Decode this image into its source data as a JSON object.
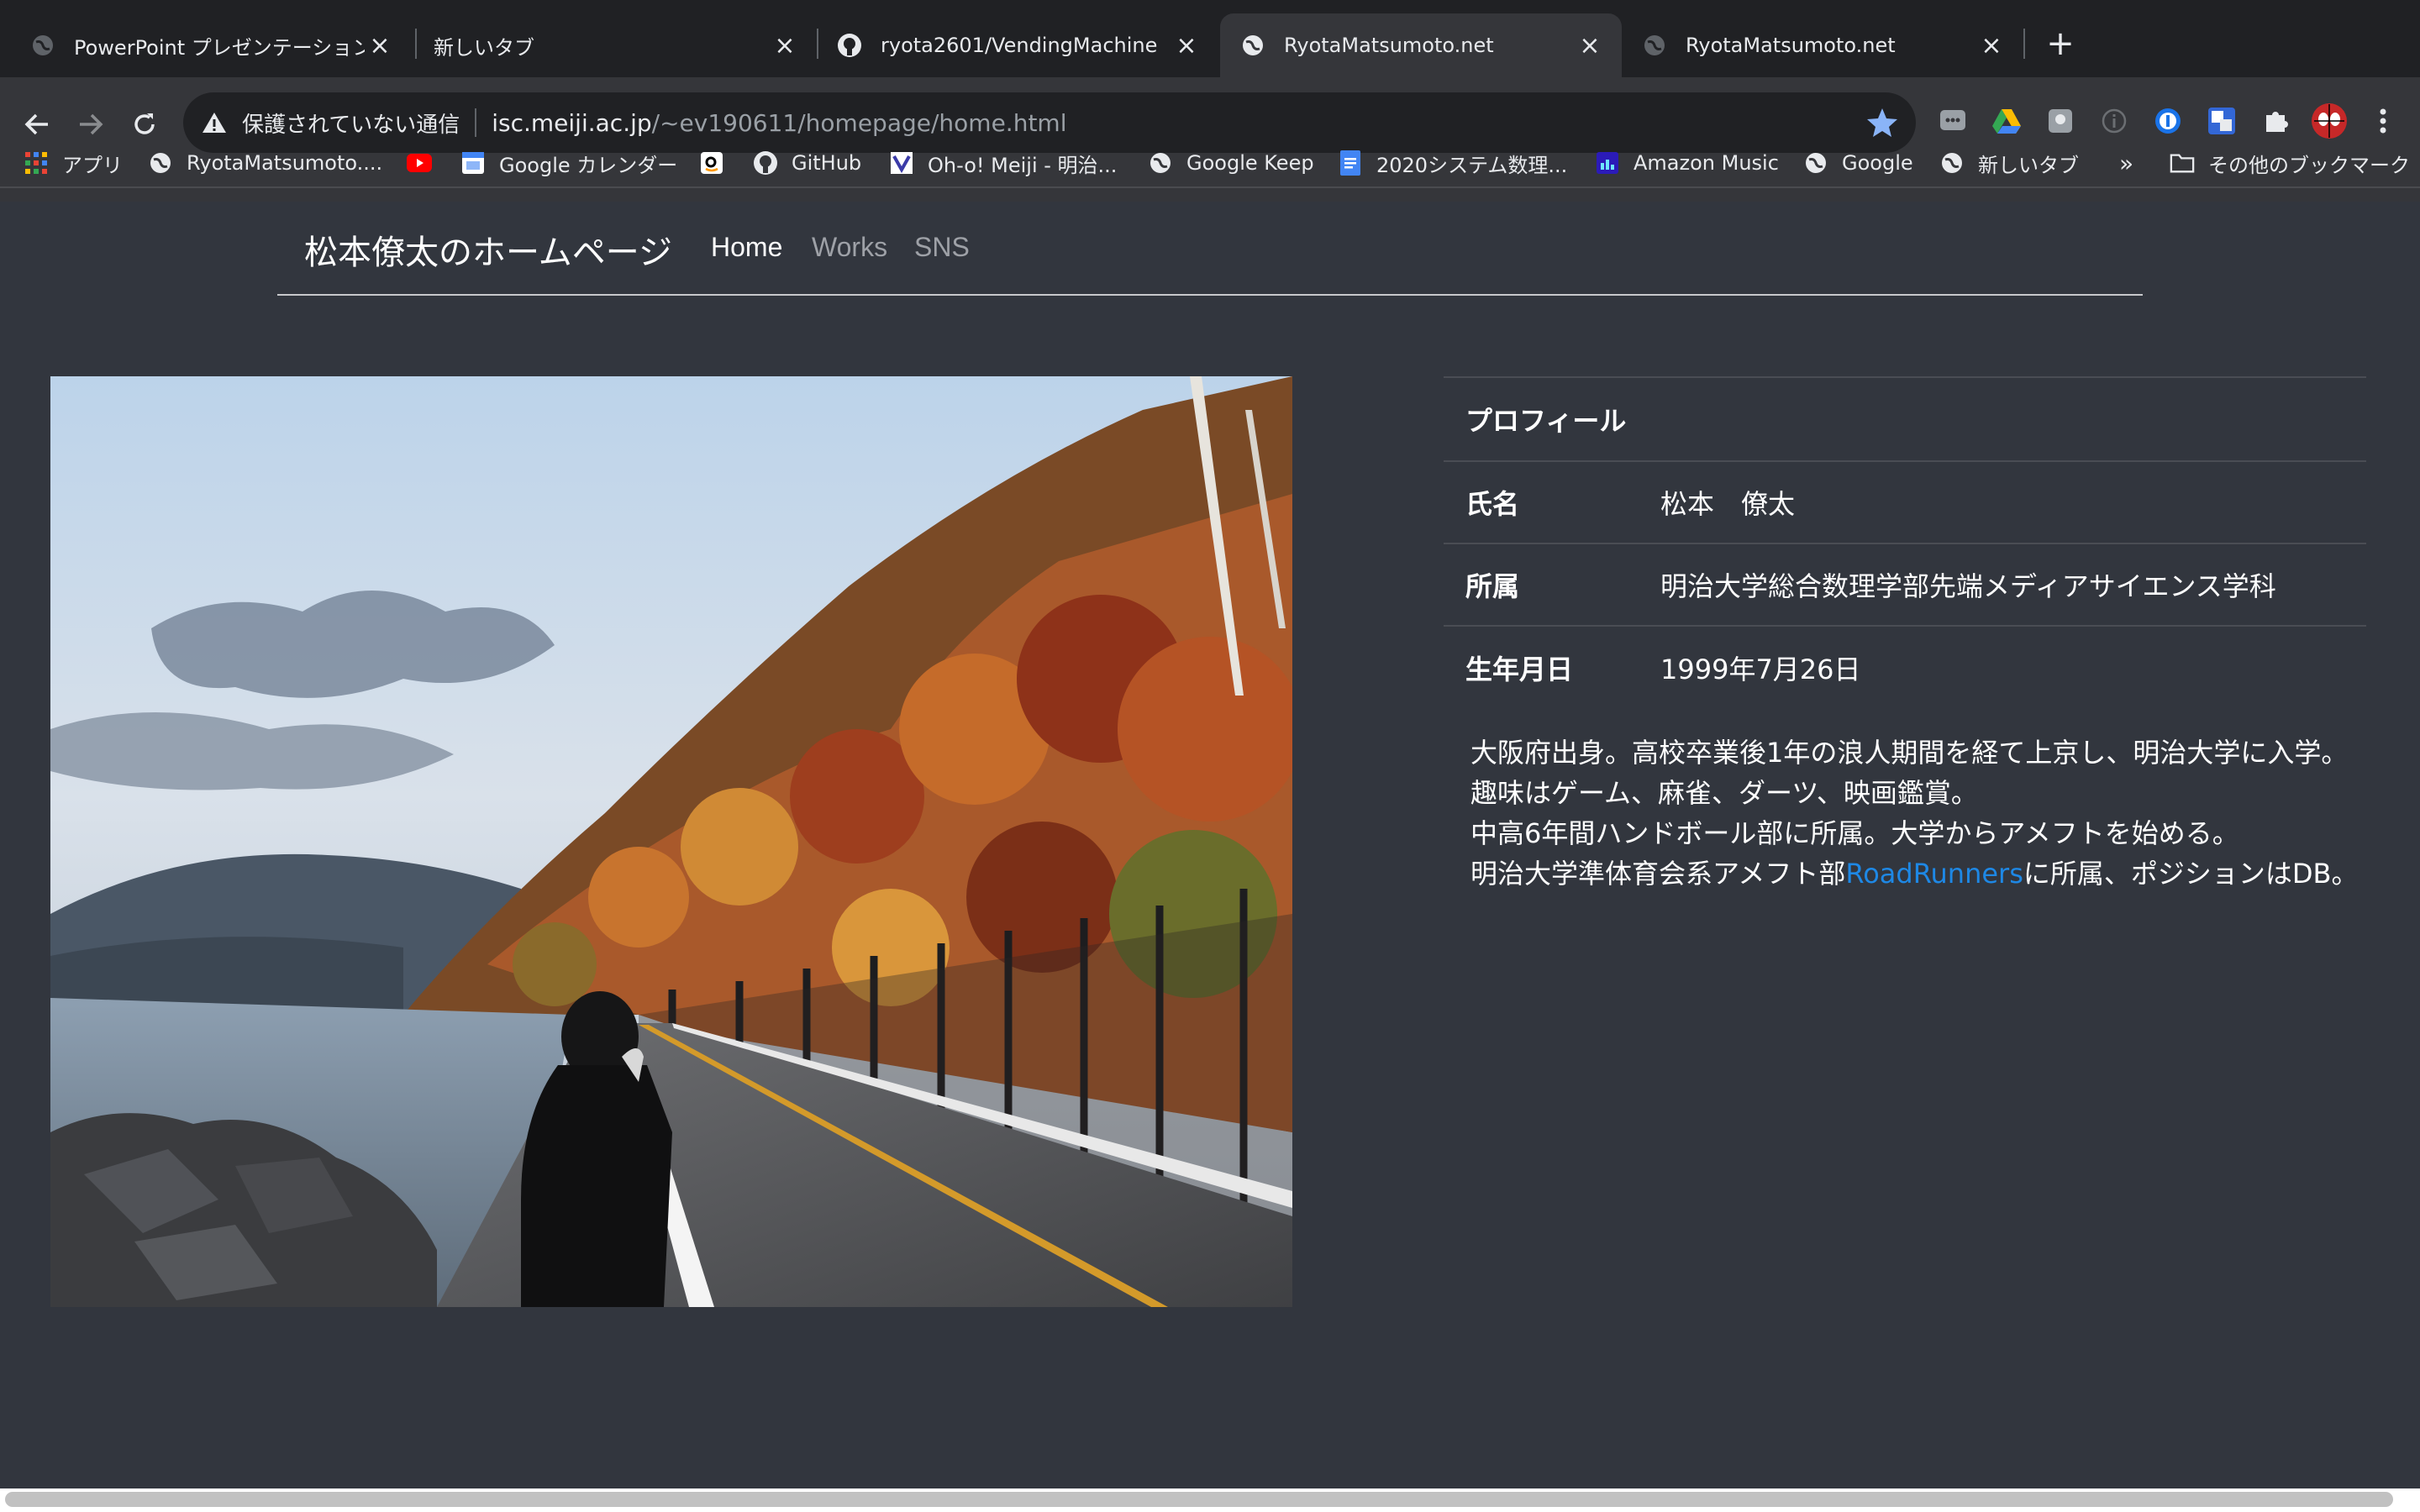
{
  "browser": {
    "tabs": [
      {
        "title": "PowerPoint プレゼンテーション",
        "icon": "globe-icon",
        "active": false
      },
      {
        "title": "新しいタブ",
        "icon": "none",
        "active": false
      },
      {
        "title": "ryota2601/VendingMachine",
        "icon": "github-icon",
        "active": false
      },
      {
        "title": "RyotaMatsumoto.net",
        "icon": "globe-icon",
        "active": true
      },
      {
        "title": "RyotaMatsumoto.net",
        "icon": "globe-icon",
        "active": false
      }
    ],
    "new_tab_label": "+",
    "close_glyph": "×",
    "address": {
      "security_label": "保護されていない通信",
      "host": "isc.meiji.ac.jp",
      "path": "/~ev190611/homepage/home.html"
    },
    "bookmarks": [
      {
        "label": "アプリ",
        "icon": "apps-grid-icon"
      },
      {
        "label": "RyotaMatsumoto....",
        "icon": "globe-icon"
      },
      {
        "label": "",
        "icon": "youtube-icon"
      },
      {
        "label": "Google カレンダー",
        "icon": "calendar-icon"
      },
      {
        "label": "",
        "icon": "amazon-icon"
      },
      {
        "label": "GitHub",
        "icon": "github-icon"
      },
      {
        "label": "Oh-o! Meiji - 明治...",
        "icon": "meiji-icon"
      },
      {
        "label": "Google Keep",
        "icon": "globe-icon"
      },
      {
        "label": "2020システム数理...",
        "icon": "docs-icon"
      },
      {
        "label": "Amazon Music",
        "icon": "amazon-music-icon"
      },
      {
        "label": "Google",
        "icon": "globe-icon"
      },
      {
        "label": "新しいタブ",
        "icon": "globe-icon"
      }
    ],
    "bookmarks_overflow": "»",
    "other_bookmarks": "その他のブックマーク",
    "colors": {
      "frame": "#202124",
      "toolbar": "#35363a",
      "page_bg": "#32363e",
      "link": "#1e88e5",
      "star": "#8ab4f8"
    }
  },
  "site": {
    "brand": "松本僚太のホームページ",
    "nav": [
      {
        "label": "Home",
        "current": true
      },
      {
        "label": "Works",
        "current": false
      },
      {
        "label": "SNS",
        "current": false
      }
    ]
  },
  "profile": {
    "heading": "プロフィール",
    "rows": [
      {
        "label": "氏名",
        "value": "松本　僚太"
      },
      {
        "label": "所属",
        "value": "明治大学総合数理学部先端メディアサイエンス学科"
      },
      {
        "label": "生年月日",
        "value": "1999年7月26日"
      }
    ]
  },
  "bio": {
    "line1": "大阪府出身。高校卒業後1年の浪人期間を経て上京し、明治大学に入学。",
    "line2": "趣味はゲーム、麻雀、ダーツ、映画鑑賞。",
    "line3": "中高6年間ハンドボール部に所属。大学からアメフトを始める。",
    "line4_before": "明治大学準体育会系アメフト部",
    "line4_link": "RoadRunners",
    "line4_after": "に所属、ポジションはDB。"
  }
}
